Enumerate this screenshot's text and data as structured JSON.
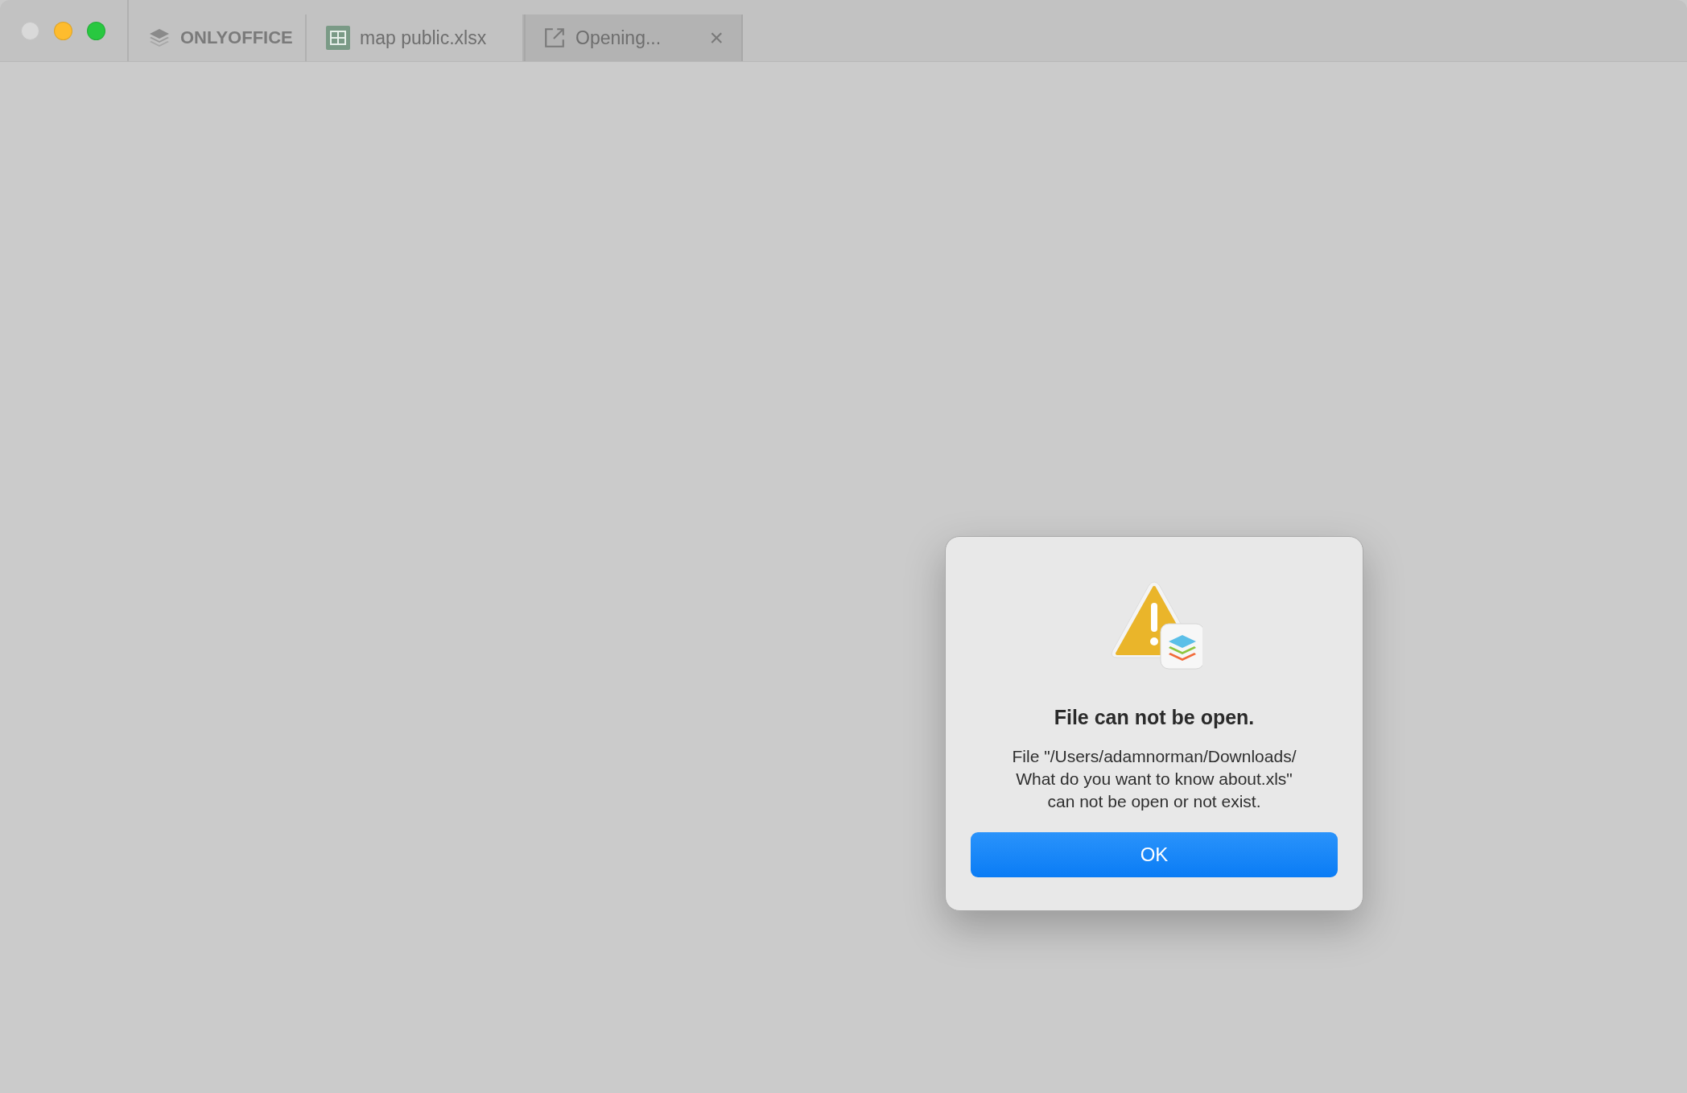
{
  "window": {
    "controls": [
      {
        "kind": "close",
        "disabled": true
      },
      {
        "kind": "minimize",
        "disabled": false
      },
      {
        "kind": "zoom",
        "disabled": false
      }
    ]
  },
  "tabs": [
    {
      "kind": "home",
      "label": "ONLYOFFICE",
      "selected": false
    },
    {
      "kind": "spreadsheet",
      "label": "map public.xlsx",
      "selected": false
    },
    {
      "kind": "opening",
      "label": "Opening...",
      "selected": true,
      "close": "×"
    }
  ],
  "dialog": {
    "title": "File can not be open.",
    "message": "File \"/Users/adamnorman/Downloads/\nWhat do you want to know about.xls\"\ncan not be open or not exist.",
    "buttons": [
      "OK"
    ]
  }
}
